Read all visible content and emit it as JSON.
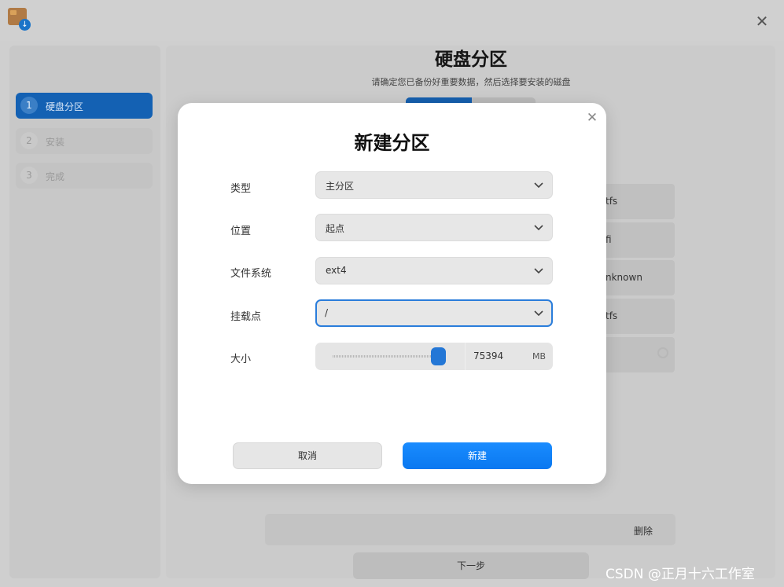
{
  "window": {
    "close_icon": "close-icon",
    "watermark": "CSDN @正月十六工作室"
  },
  "sidebar": {
    "steps": [
      {
        "num": "1",
        "label": "硬盘分区",
        "active": true
      },
      {
        "num": "2",
        "label": "安装",
        "active": false
      },
      {
        "num": "3",
        "label": "完成",
        "active": false
      }
    ]
  },
  "page": {
    "title": "硬盘分区",
    "subtitle": "请确定您已备份好重要数据，然后选择要安装的磁盘",
    "partition_rows": [
      "tfs",
      "fi",
      "nknown",
      "tfs"
    ],
    "delete_label": "删除",
    "next_label": "下一步"
  },
  "dialog": {
    "title": "新建分区",
    "fields": {
      "type": {
        "label": "类型",
        "value": "主分区"
      },
      "position": {
        "label": "位置",
        "value": "起点"
      },
      "filesystem": {
        "label": "文件系统",
        "value": "ext4"
      },
      "mountpoint": {
        "label": "挂载点",
        "value": "/"
      },
      "size": {
        "label": "大小",
        "value": "75394",
        "unit": "MB"
      }
    },
    "cancel_label": "取消",
    "create_label": "新建"
  },
  "colors": {
    "accent": "#1a8cff",
    "sidebar_active": "#1461b3"
  }
}
